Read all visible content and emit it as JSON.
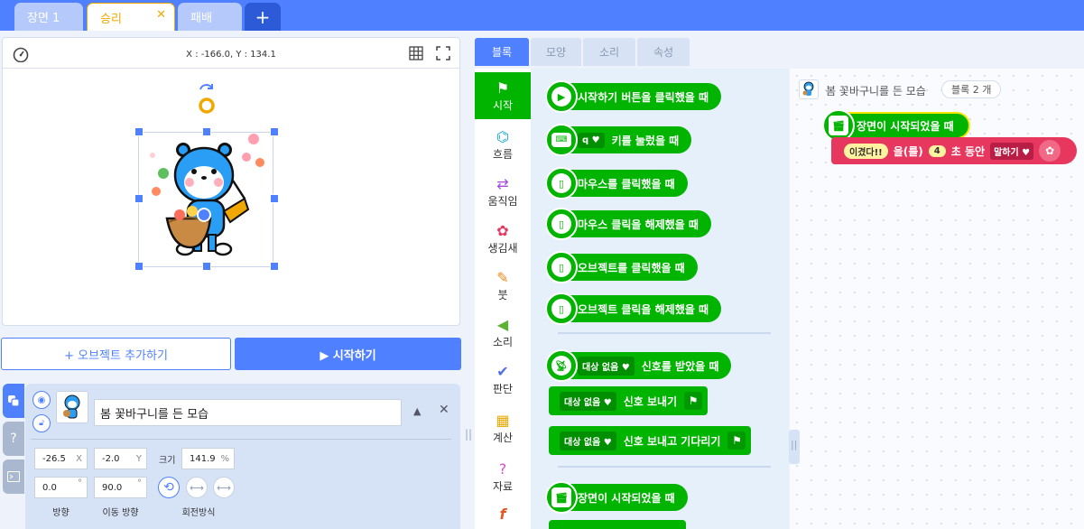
{
  "scene_tabs": {
    "tab1": "장면 1",
    "tab2": "승리",
    "tab3": "패배",
    "add": "+",
    "close": "✕"
  },
  "stage": {
    "coords": "X : -166.0, Y : 134.1"
  },
  "buttons": {
    "add_object": "+ 오브젝트 추가하기",
    "start": "▶ 시작하기"
  },
  "object": {
    "name": "봄 꽃바구니를 든 모습",
    "x": "-26.5",
    "x_unit": "X",
    "y": "-2.0",
    "y_unit": "Y",
    "size_label": "크기",
    "size": "141.9",
    "size_unit": "%",
    "direction": "0.0",
    "direction_unit": "°",
    "direction_label": "방향",
    "move_direction": "90.0",
    "move_direction_unit": "°",
    "move_direction_label": "이동 방향",
    "rotation_label": "회전방식"
  },
  "side_tabs": {
    "help": "?"
  },
  "block_tabs": [
    "블록",
    "모양",
    "소리",
    "속성"
  ],
  "categories": [
    "시작",
    "흐름",
    "움직임",
    "생김새",
    "붓",
    "소리",
    "판단",
    "계산",
    "자료"
  ],
  "palette": {
    "b1": "시작하기 버튼을 클릭했을 때",
    "b2_key": "q",
    "b2": "키를 눌렀을 때",
    "b3": "마우스를 클릭했을 때",
    "b4": "마우스 클릭을 해제했을 때",
    "b5": "오브젝트를 클릭했을 때",
    "b6": "오브젝트 클릭을 해제했을 때",
    "signal_none": "대상 없음",
    "b7": "신호를 받았을 때",
    "b8": "신호 보내기",
    "b9": "신호 보내고 기다리기",
    "b10": "장면이 시작되었을 때"
  },
  "code": {
    "object_name": "봄 꽃바구니를 든 모습",
    "block_count": "블록 2 개",
    "hat": "장면이 시작되었을 때",
    "say_text": "이겼다!!",
    "say_particle": "을(를)",
    "say_seconds": "4",
    "say_unit": "초 동안",
    "say_mode": "말하기"
  },
  "colors": {
    "accent": "#4f80ff",
    "start_block": "#00b400",
    "looks_block": "#e8375f"
  }
}
